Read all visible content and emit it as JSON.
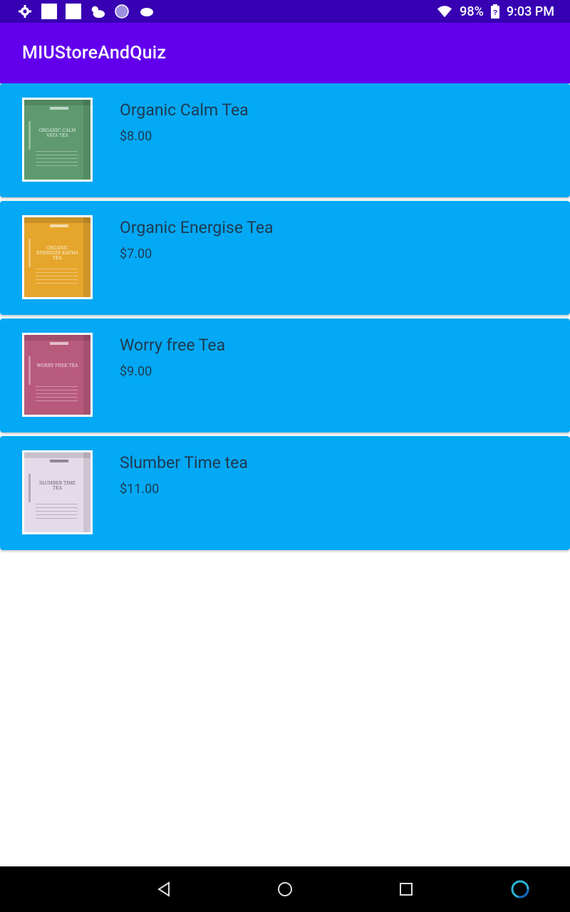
{
  "status_bar": {
    "battery_percent": "98%",
    "time": "9:03 PM",
    "icons_left": [
      "settings-icon",
      "square-notification-icon",
      "square-notification-icon",
      "weather-icon",
      "circle-notification-icon",
      "cloud-icon"
    ],
    "icons_right": [
      "wifi-icon",
      "battery-icon"
    ]
  },
  "app_bar": {
    "title": "MIUStoreAndQuiz"
  },
  "products": [
    {
      "name": "Organic Calm Tea",
      "price": "$8.00",
      "box_color": "#5e9a6e",
      "box_label": "ORGANIC CALM VATA TEA"
    },
    {
      "name": "Organic Energise Tea",
      "price": "$7.00",
      "box_color": "#e6a62c",
      "box_label": "ORGANIC ENERGIZE KAPHA TEA"
    },
    {
      "name": "Worry free Tea",
      "price": "$9.00",
      "box_color": "#b85a7c",
      "box_label": "WORRY FREE TEA"
    },
    {
      "name": "Slumber Time tea",
      "price": "$11.00",
      "box_color": "#e4dbe8",
      "box_label": "SLUMBER TIME TEA"
    }
  ],
  "colors": {
    "status_bar": "#3700B3",
    "app_bar": "#6200EE",
    "card": "#03A9F4",
    "text": "#1f3a52"
  },
  "nav_bar": {
    "icons": [
      "back-icon",
      "home-icon",
      "recents-icon",
      "assistant-icon"
    ]
  }
}
